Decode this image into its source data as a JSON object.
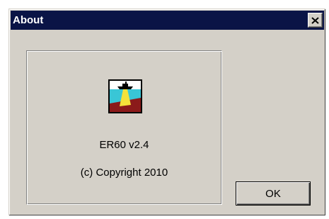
{
  "window": {
    "title": "About",
    "titlebar_color": "#0a1446",
    "face_color": "#d4d0c8"
  },
  "titlebar": {
    "close_icon": "close-icon"
  },
  "about": {
    "app_icon": "sonar-ship-icon",
    "product_name": "ER60 v2.4",
    "copyright": "(c) Copyright 2010"
  },
  "buttons": {
    "ok_label": "OK"
  }
}
